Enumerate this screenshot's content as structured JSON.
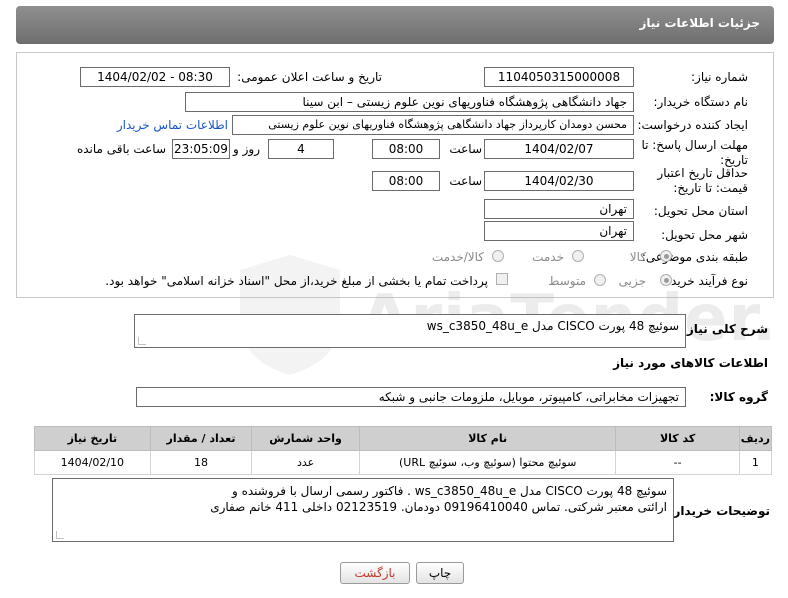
{
  "header": {
    "title": "جزئیات اطلاعات نیاز"
  },
  "fields": {
    "need_number_label": "شماره نیاز:",
    "need_number": "1104050315000008",
    "announce_label": "تاریخ و ساعت اعلان عمومی:",
    "announce_value": "1404/02/02 - 08:30",
    "buyer_label": "نام دستگاه خریدار:",
    "buyer_value": "جهاد دانشگاهی پژوهشگاه فناوریهای نوین علوم زیستی – ابن سینا",
    "creator_label": "ایجاد کننده درخواست:",
    "creator_value": "محسن دومدان کارپرداز جهاد دانشگاهی پژوهشگاه فناوریهای نوین علوم زیستی",
    "contact_link": "اطلاعات تماس خریدار",
    "reply_deadline_label": "مهلت ارسال پاسخ: تا تاریخ:",
    "reply_date": "1404/02/07",
    "time_label": "ساعت",
    "reply_time": "08:00",
    "days_value": "4",
    "days_label": "روز و",
    "remaining_time": "23:05:09",
    "remaining_label": "ساعت باقی مانده",
    "price_deadline_label": "حداقل تاریخ اعتبار قیمت: تا تاریخ:",
    "price_date": "1404/02/30",
    "price_time": "08:00",
    "province_label": "استان محل تحویل:",
    "province_value": "تهران",
    "city_label": "شهر محل تحویل:",
    "city_value": "تهران",
    "category_label": "طبقه بندی موضوعی:",
    "category_options": [
      "کالا",
      "خدمت",
      "کالا/خدمت"
    ],
    "process_label": "نوع فرآیند خرید :",
    "process_options": [
      "جزیی",
      "متوسط"
    ],
    "payment_note": "پرداخت تمام یا بخشی از مبلغ خرید،از محل \"اسناد خزانه اسلامی\" خواهد بود."
  },
  "description": {
    "label": "شرح کلی نیاز:",
    "value": "سوئیچ 48 پورت CISCO مدل ws_c3850_48u_e"
  },
  "goods_info": {
    "title": "اطلاعات کالاهای مورد نیاز",
    "group_label": "گروه کالا:",
    "group_value": "تجهیزات مخابراتی، کامپیوتر، موبایل، ملزومات جانبی و شبکه"
  },
  "table": {
    "headers": [
      "ردیف",
      "کد کالا",
      "نام کالا",
      "واحد شمارش",
      "تعداد / مقدار",
      "تاریخ نیاز"
    ],
    "rows": [
      [
        "1",
        "--",
        "سوئیچ محتوا (سوئیچ وب، سوئیچ URL)",
        "عدد",
        "18",
        "1404/02/10"
      ]
    ]
  },
  "buyer_notes": {
    "label": "توضیحات خریدار:",
    "line1": "سوئیچ 48 پورت CISCO مدل ws_c3850_48u_e . فاکتور رسمی  ارسال با فروشنده و",
    "line2": "ارائتی معتبر شرکتی. تماس 09196410040 دودمان. 02123519 داخلی 411 خانم صفاری"
  },
  "buttons": {
    "print": "چاپ",
    "back": "بازگشت"
  },
  "colors": {
    "header_bg": "#7d7d7d",
    "link": "#1a55c8",
    "back_text": "#c0392b"
  }
}
